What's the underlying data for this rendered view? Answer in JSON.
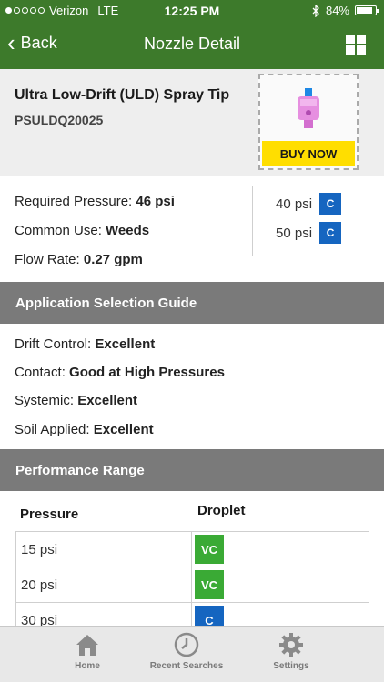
{
  "status_bar": {
    "carrier": "Verizon",
    "network": "LTE",
    "time": "12:25 PM",
    "battery_pct": "84%",
    "battery_level": 0.84
  },
  "nav": {
    "back_label": "Back",
    "title": "Nozzle Detail",
    "grid_icon": "grid-icon"
  },
  "product": {
    "name": "Ultra Low-Drift (ULD) Spray Tip",
    "code": "PSULDQ20025",
    "buy_label": "BUY NOW"
  },
  "details": {
    "required_pressure_label": "Required Pressure:",
    "required_pressure_value": "46 psi",
    "common_use_label": "Common Use:",
    "common_use_value": "Weeds",
    "flow_rate_label": "Flow Rate:",
    "flow_rate_value": "0.27 gpm",
    "pressure_classes": [
      {
        "psi": "40 psi",
        "class": "C",
        "color": "#1565c0"
      },
      {
        "psi": "50 psi",
        "class": "C",
        "color": "#1565c0"
      }
    ]
  },
  "guide": {
    "title": "Application Selection Guide",
    "rows": [
      {
        "label": "Drift Control:",
        "value": "Excellent"
      },
      {
        "label": "Contact:",
        "value": "Good at High Pressures"
      },
      {
        "label": "Systemic:",
        "value": "Excellent"
      },
      {
        "label": "Soil Applied:",
        "value": "Excellent"
      }
    ]
  },
  "performance": {
    "title": "Performance Range",
    "col_pressure": "Pressure",
    "col_droplet": "Droplet",
    "rows": [
      {
        "psi": "15 psi",
        "droplet": "VC",
        "color": "#3aaa35"
      },
      {
        "psi": "20 psi",
        "droplet": "VC",
        "color": "#3aaa35"
      },
      {
        "psi": "30 psi",
        "droplet": "C",
        "color": "#1565c0"
      }
    ]
  },
  "tabs": [
    {
      "label": "Home",
      "icon": "home-icon"
    },
    {
      "label": "Recent Searches",
      "icon": "clock-icon"
    },
    {
      "label": "Settings",
      "icon": "gear-icon"
    }
  ],
  "colors": {
    "header_green": "#3d7a2b",
    "section_gray": "#7a7a7a",
    "buy_yellow": "#ffde00"
  }
}
